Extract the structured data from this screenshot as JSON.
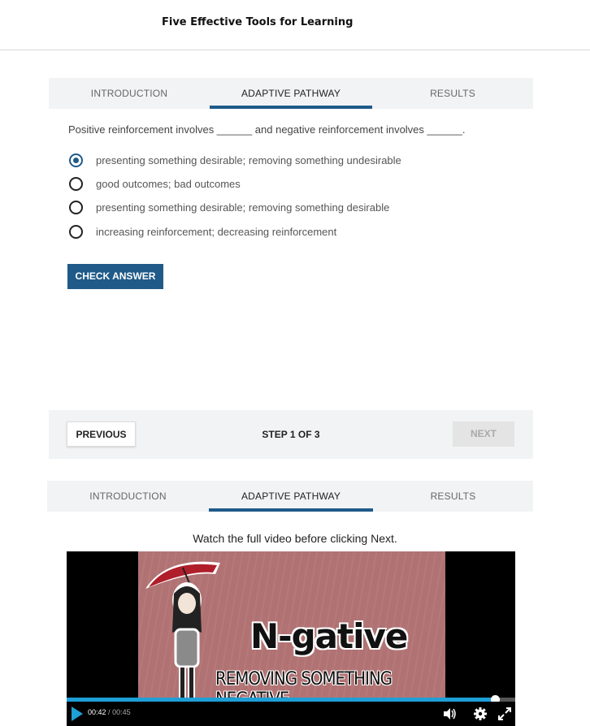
{
  "page": {
    "title": "Five Effective Tools for Learning"
  },
  "tabs_top": [
    {
      "label": "INTRODUCTION",
      "active": false
    },
    {
      "label": "ADAPTIVE PATHWAY",
      "active": true
    },
    {
      "label": "RESULTS",
      "active": false
    }
  ],
  "quiz": {
    "question": "Positive reinforcement involves ______ and negative reinforcement involves ______.",
    "options": [
      {
        "label": "presenting something desirable; removing something undesirable",
        "selected": true
      },
      {
        "label": "good outcomes; bad outcomes",
        "selected": false
      },
      {
        "label": "presenting something desirable; removing something desirable",
        "selected": false
      },
      {
        "label": "increasing reinforcement; decreasing reinforcement",
        "selected": false
      }
    ],
    "check_button": "CHECK ANSWER"
  },
  "stepper": {
    "previous": "PREVIOUS",
    "step": "STEP 1 OF 3",
    "next": "NEXT",
    "next_enabled": false
  },
  "tabs_bottom": [
    {
      "label": "INTRODUCTION",
      "active": false
    },
    {
      "label": "ADAPTIVE PATHWAY",
      "active": true
    },
    {
      "label": "RESULTS",
      "active": false
    }
  ],
  "video_section": {
    "instruction": "Watch the full video before clicking Next.",
    "frame_title": "N-gative",
    "frame_subtitle": "REMOVING SOMETHING NEGATIVE",
    "current_time": "00:42",
    "time_separator": "/",
    "duration": "00:45",
    "progress": 0.955
  },
  "colors": {
    "accent": "#1f5a89",
    "video_progress": "#1e9fd6",
    "frame_background": "#b17273",
    "umbrella": "#b01e2a"
  },
  "icons": {
    "play": "play-icon",
    "volume": "volume-icon",
    "settings": "gear-icon",
    "fullscreen": "fullscreen-icon"
  }
}
